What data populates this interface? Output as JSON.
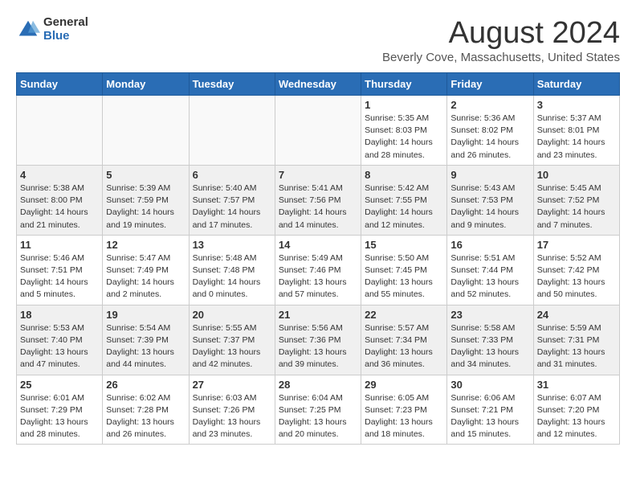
{
  "header": {
    "logo_general": "General",
    "logo_blue": "Blue",
    "month_year": "August 2024",
    "location": "Beverly Cove, Massachusetts, United States"
  },
  "days_of_week": [
    "Sunday",
    "Monday",
    "Tuesday",
    "Wednesday",
    "Thursday",
    "Friday",
    "Saturday"
  ],
  "weeks": [
    [
      {
        "day": "",
        "empty": true
      },
      {
        "day": "",
        "empty": true
      },
      {
        "day": "",
        "empty": true
      },
      {
        "day": "",
        "empty": true
      },
      {
        "day": "1",
        "sunrise": "5:35 AM",
        "sunset": "8:03 PM",
        "daylight": "14 hours and 28 minutes."
      },
      {
        "day": "2",
        "sunrise": "5:36 AM",
        "sunset": "8:02 PM",
        "daylight": "14 hours and 26 minutes."
      },
      {
        "day": "3",
        "sunrise": "5:37 AM",
        "sunset": "8:01 PM",
        "daylight": "14 hours and 23 minutes."
      }
    ],
    [
      {
        "day": "4",
        "sunrise": "5:38 AM",
        "sunset": "8:00 PM",
        "daylight": "14 hours and 21 minutes."
      },
      {
        "day": "5",
        "sunrise": "5:39 AM",
        "sunset": "7:59 PM",
        "daylight": "14 hours and 19 minutes."
      },
      {
        "day": "6",
        "sunrise": "5:40 AM",
        "sunset": "7:57 PM",
        "daylight": "14 hours and 17 minutes."
      },
      {
        "day": "7",
        "sunrise": "5:41 AM",
        "sunset": "7:56 PM",
        "daylight": "14 hours and 14 minutes."
      },
      {
        "day": "8",
        "sunrise": "5:42 AM",
        "sunset": "7:55 PM",
        "daylight": "14 hours and 12 minutes."
      },
      {
        "day": "9",
        "sunrise": "5:43 AM",
        "sunset": "7:53 PM",
        "daylight": "14 hours and 9 minutes."
      },
      {
        "day": "10",
        "sunrise": "5:45 AM",
        "sunset": "7:52 PM",
        "daylight": "14 hours and 7 minutes."
      }
    ],
    [
      {
        "day": "11",
        "sunrise": "5:46 AM",
        "sunset": "7:51 PM",
        "daylight": "14 hours and 5 minutes."
      },
      {
        "day": "12",
        "sunrise": "5:47 AM",
        "sunset": "7:49 PM",
        "daylight": "14 hours and 2 minutes."
      },
      {
        "day": "13",
        "sunrise": "5:48 AM",
        "sunset": "7:48 PM",
        "daylight": "14 hours and 0 minutes."
      },
      {
        "day": "14",
        "sunrise": "5:49 AM",
        "sunset": "7:46 PM",
        "daylight": "13 hours and 57 minutes."
      },
      {
        "day": "15",
        "sunrise": "5:50 AM",
        "sunset": "7:45 PM",
        "daylight": "13 hours and 55 minutes."
      },
      {
        "day": "16",
        "sunrise": "5:51 AM",
        "sunset": "7:44 PM",
        "daylight": "13 hours and 52 minutes."
      },
      {
        "day": "17",
        "sunrise": "5:52 AM",
        "sunset": "7:42 PM",
        "daylight": "13 hours and 50 minutes."
      }
    ],
    [
      {
        "day": "18",
        "sunrise": "5:53 AM",
        "sunset": "7:40 PM",
        "daylight": "13 hours and 47 minutes."
      },
      {
        "day": "19",
        "sunrise": "5:54 AM",
        "sunset": "7:39 PM",
        "daylight": "13 hours and 44 minutes."
      },
      {
        "day": "20",
        "sunrise": "5:55 AM",
        "sunset": "7:37 PM",
        "daylight": "13 hours and 42 minutes."
      },
      {
        "day": "21",
        "sunrise": "5:56 AM",
        "sunset": "7:36 PM",
        "daylight": "13 hours and 39 minutes."
      },
      {
        "day": "22",
        "sunrise": "5:57 AM",
        "sunset": "7:34 PM",
        "daylight": "13 hours and 36 minutes."
      },
      {
        "day": "23",
        "sunrise": "5:58 AM",
        "sunset": "7:33 PM",
        "daylight": "13 hours and 34 minutes."
      },
      {
        "day": "24",
        "sunrise": "5:59 AM",
        "sunset": "7:31 PM",
        "daylight": "13 hours and 31 minutes."
      }
    ],
    [
      {
        "day": "25",
        "sunrise": "6:01 AM",
        "sunset": "7:29 PM",
        "daylight": "13 hours and 28 minutes."
      },
      {
        "day": "26",
        "sunrise": "6:02 AM",
        "sunset": "7:28 PM",
        "daylight": "13 hours and 26 minutes."
      },
      {
        "day": "27",
        "sunrise": "6:03 AM",
        "sunset": "7:26 PM",
        "daylight": "13 hours and 23 minutes."
      },
      {
        "day": "28",
        "sunrise": "6:04 AM",
        "sunset": "7:25 PM",
        "daylight": "13 hours and 20 minutes."
      },
      {
        "day": "29",
        "sunrise": "6:05 AM",
        "sunset": "7:23 PM",
        "daylight": "13 hours and 18 minutes."
      },
      {
        "day": "30",
        "sunrise": "6:06 AM",
        "sunset": "7:21 PM",
        "daylight": "13 hours and 15 minutes."
      },
      {
        "day": "31",
        "sunrise": "6:07 AM",
        "sunset": "7:20 PM",
        "daylight": "13 hours and 12 minutes."
      }
    ]
  ]
}
